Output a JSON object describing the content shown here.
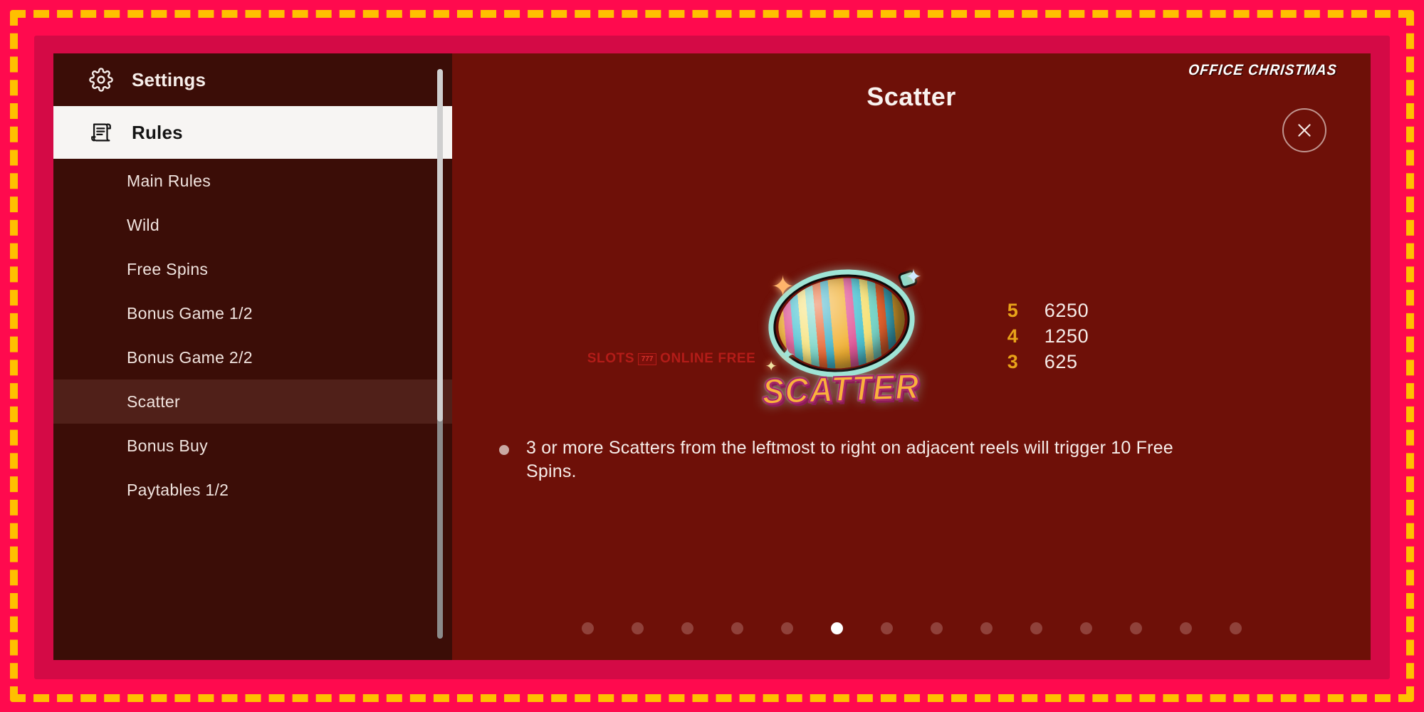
{
  "frame": {
    "outer_bg": "#ff0a4e",
    "dash_color": "#ffc000",
    "band_color": "#d40a46"
  },
  "sidebar": {
    "bg": "#3b0d07",
    "selected_bg": "#502019",
    "head_items": [
      {
        "label": "Settings",
        "icon": "gear-icon",
        "active": false
      },
      {
        "label": "Rules",
        "icon": "scroll-document-icon",
        "active": true
      }
    ],
    "sub_items": [
      {
        "label": "Main Rules",
        "selected": false
      },
      {
        "label": "Wild",
        "selected": false
      },
      {
        "label": "Free Spins",
        "selected": false
      },
      {
        "label": "Bonus Game 1/2",
        "selected": false
      },
      {
        "label": "Bonus Game 2/2",
        "selected": false
      },
      {
        "label": "Scatter",
        "selected": true
      },
      {
        "label": "Bonus Buy",
        "selected": false
      },
      {
        "label": "Paytables 1/2",
        "selected": false
      }
    ]
  },
  "content": {
    "bg": "#6e1008",
    "brand": "OFFICE CHRISTMAS",
    "title": "Scatter",
    "close_icon": "close-x-icon",
    "symbol": {
      "name": "scatter-disco-ball-symbol",
      "word": "SCATTER",
      "watermark": "SLOTS ONLINE FREE",
      "watermark_chip": "777"
    },
    "paytable": {
      "rows": [
        {
          "count": "5",
          "value": "6250"
        },
        {
          "count": "4",
          "value": "1250"
        },
        {
          "count": "3",
          "value": "625"
        }
      ],
      "count_color": "#e8a319",
      "value_color": "#f6ece8"
    },
    "bullets": [
      "3 or more Scatters from the leftmost to right on adjacent reels will trigger 10 Free Spins."
    ],
    "pagination": {
      "total": 14,
      "active_index": 6
    }
  }
}
